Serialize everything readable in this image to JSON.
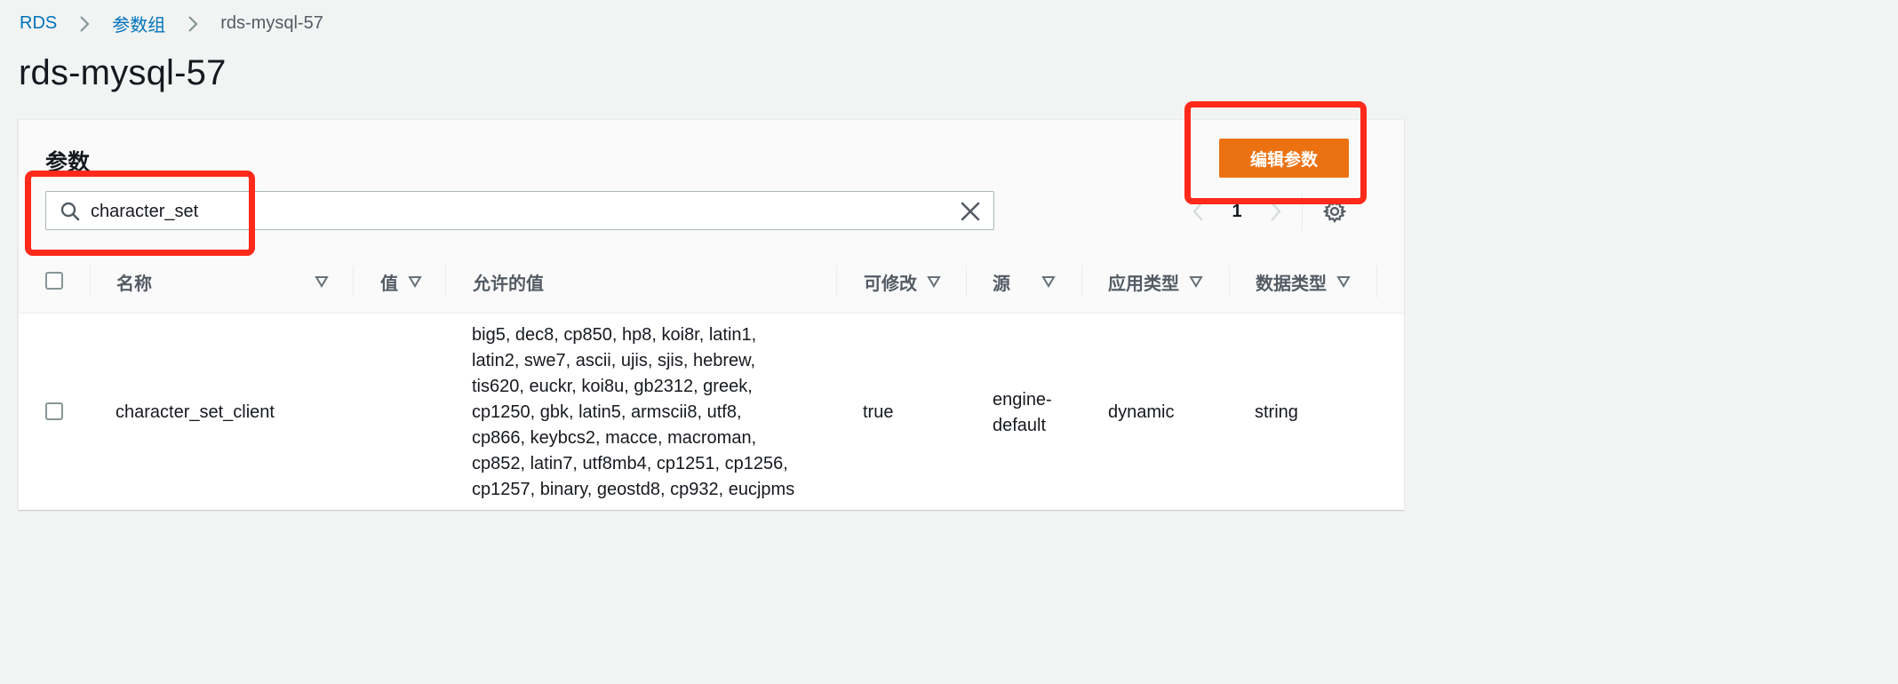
{
  "breadcrumb": {
    "items": [
      "RDS",
      "参数组"
    ],
    "current": "rds-mysql-57"
  },
  "page_title": "rds-mysql-57",
  "panel": {
    "heading": "参数",
    "edit_button_label": "编辑参数",
    "search": {
      "value": "character_set"
    },
    "pagination": {
      "current_page": "1"
    }
  },
  "table": {
    "columns": [
      "名称",
      "值",
      "允许的值",
      "可修改",
      "源",
      "应用类型",
      "数据类型"
    ],
    "rows": [
      {
        "name": "character_set_client",
        "value": "",
        "allowed_values_lines": [
          "big5, dec8, cp850, hp8, koi8r, latin1,",
          "latin2, swe7, ascii, ujis, sjis, hebrew,",
          "tis620, euckr, koi8u, gb2312, greek,",
          "cp1250, gbk, latin5, armscii8, utf8,",
          "cp866, keybcs2, macce, macroman,",
          "cp852, latin7, utf8mb4, cp1251, cp1256,",
          "cp1257, binary, geostd8, cp932, eucjpms"
        ],
        "modifiable": "true",
        "source_lines": [
          "engine-",
          "default"
        ],
        "apply_type": "dynamic",
        "data_type": "string"
      }
    ]
  },
  "colors": {
    "accent_link": "#0073bb",
    "primary_button": "#ec7211",
    "highlight_box": "#ff2a1a"
  },
  "icons": [
    "chevron-right-icon",
    "search-icon",
    "close-icon",
    "chevron-left-icon",
    "settings-gear-icon",
    "sort-caret-icon"
  ]
}
